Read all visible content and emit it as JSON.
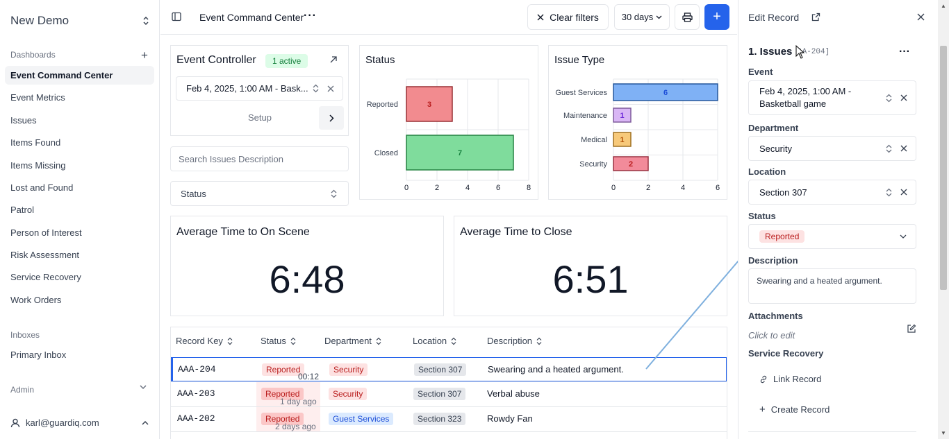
{
  "sidebar": {
    "workspace": "New Demo",
    "dashboards_header": "Dashboards",
    "items": [
      "Event Command Center",
      "Event Metrics",
      "Issues",
      "Items Found",
      "Items Missing",
      "Lost and Found",
      "Patrol",
      "Person of Interest",
      "Risk Assessment",
      "Service Recovery",
      "Work Orders"
    ],
    "inboxes_header": "Inboxes",
    "inbox_items": [
      "Primary Inbox"
    ],
    "admin_header": "Admin",
    "user": "karl@guardiq.com"
  },
  "topbar": {
    "title": "Event Command Center",
    "clear_filters": "Clear filters",
    "range": "30 days"
  },
  "controller": {
    "title": "Event Controller",
    "badge": "1 active",
    "event": "Feb 4, 2025, 1:00 AM - Bask...",
    "setup": "Setup"
  },
  "search": {
    "placeholder": "Search Issues Description"
  },
  "status_filter": "Status",
  "chart_data": [
    {
      "type": "bar",
      "title": "Status",
      "orientation": "horizontal",
      "categories": [
        "Reported",
        "Closed"
      ],
      "values": [
        3,
        7
      ],
      "xlim": [
        0,
        8
      ],
      "xticks": [
        "0",
        "2",
        "4",
        "6",
        "8"
      ],
      "colors": [
        "#f28b8f",
        "#7fdc9c"
      ]
    },
    {
      "type": "bar",
      "title": "Issue Type",
      "orientation": "horizontal",
      "categories": [
        "Guest Services",
        "Maintenance",
        "Medical",
        "Security"
      ],
      "values": [
        6,
        1,
        1,
        2
      ],
      "xlim": [
        0,
        6
      ],
      "xticks": [
        "0",
        "2",
        "4",
        "6"
      ],
      "colors": [
        "#7fb1f5",
        "#d9b6f5",
        "#f7c97a",
        "#f28b9a"
      ]
    }
  ],
  "metrics": [
    {
      "title": "Average Time to On Scene",
      "value": "6:48"
    },
    {
      "title": "Average Time to Close",
      "value": "6:51"
    }
  ],
  "table": {
    "headers": [
      "Record Key",
      "Status",
      "Department",
      "Location",
      "Description"
    ],
    "rows": [
      {
        "key": "AAA-204",
        "status": "Reported",
        "time": "00:12",
        "dept": "Security",
        "loc": "Section 307",
        "desc": "Swearing and a heated argument."
      },
      {
        "key": "AAA-203",
        "status": "Reported",
        "time": "1 day ago",
        "dept": "Security",
        "loc": "Section 307",
        "desc": "Verbal abuse"
      },
      {
        "key": "AAA-202",
        "status": "Reported",
        "time": "2 days ago",
        "dept": "Guest Services",
        "loc": "Section 323",
        "desc": "Rowdy Fan"
      }
    ]
  },
  "edit_panel": {
    "title": "Edit Record",
    "record_title": "1. Issues",
    "record_key": "AA-204]",
    "event_label": "Event",
    "event_value_1": "Feb 4, 2025, 1:00 AM -",
    "event_value_2": "Basketball game",
    "dept_label": "Department",
    "dept_value": "Security",
    "location_label": "Location",
    "location_value": "Section 307",
    "status_label": "Status",
    "status_value": "Reported",
    "desc_label": "Description",
    "desc_value": "Swearing and a heated argument.",
    "attach_label": "Attachments",
    "attach_hint": "Click to edit",
    "service_label": "Service Recovery",
    "link_record": "Link Record",
    "create_record": "Create Record"
  }
}
